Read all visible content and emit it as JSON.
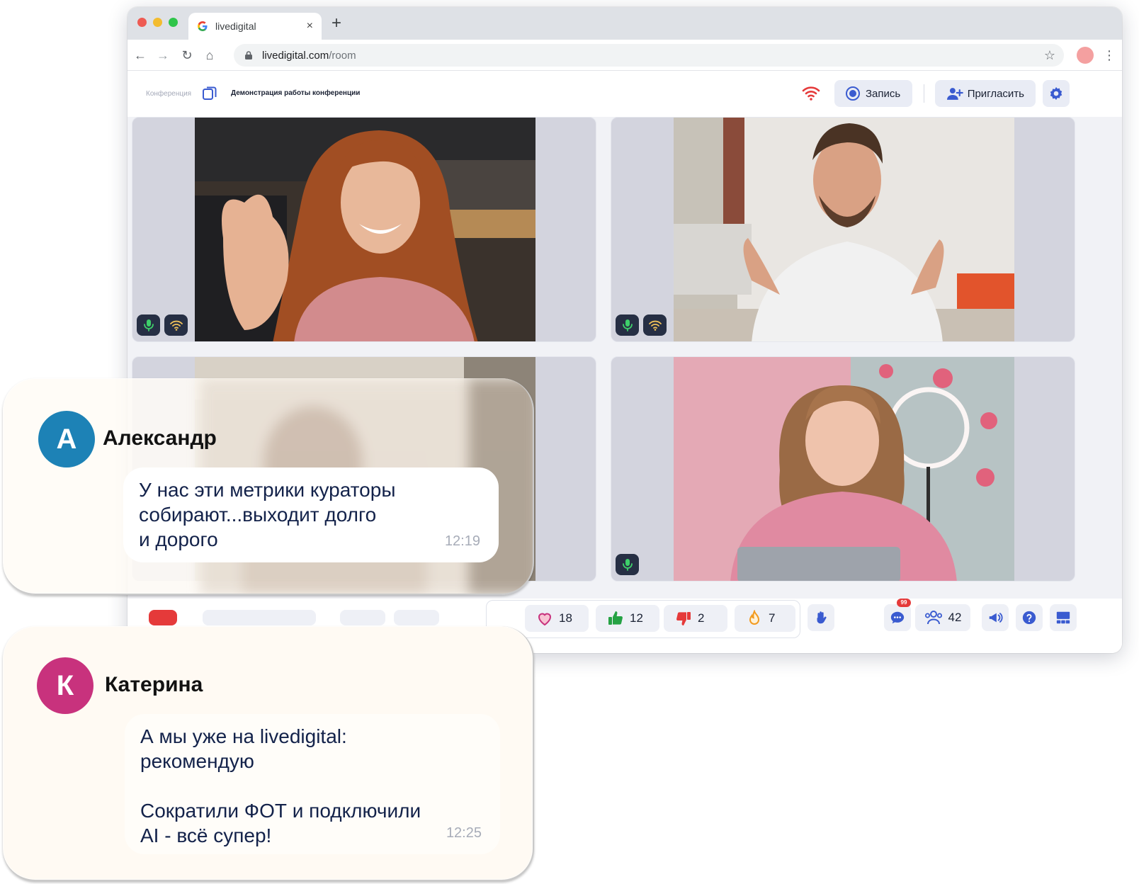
{
  "browser": {
    "tab_title": "livedigital",
    "new_tab": "+",
    "close_tab": "×",
    "url_domain": "livedigital.com",
    "url_path": "/room"
  },
  "header": {
    "breadcrumb": "Конференция",
    "conference_title": "Демонстрация работы конференции",
    "record_label": "Запись",
    "invite_label": "Пригласить"
  },
  "reactions": {
    "heart": "18",
    "like": "12",
    "dislike": "2",
    "fire": "7"
  },
  "footer": {
    "chat_unread": "99",
    "participants_count": "42"
  },
  "messages": [
    {
      "avatar_letter": "А",
      "sender": "Александр",
      "text": "У нас эти метрики кураторы\nсобирают...выходит долго\nи дорого",
      "time": "12:19",
      "avatar_color": "#1d82b6"
    },
    {
      "avatar_letter": "К",
      "sender": "Катерина",
      "text": "А мы уже на livedigital:\nрекомендую\n\nСократили ФОТ и подключили\nAI - всё супер!",
      "time": "12:25",
      "avatar_color": "#c8327d"
    }
  ],
  "colors": {
    "accent": "#3a5bd0",
    "tile_bg": "#d3d4de",
    "badge_bg": "#262f44",
    "wifi_warning": "#e53a3a"
  },
  "icons": [
    "google-icon",
    "lock-icon",
    "star-icon",
    "copy-icon",
    "wifi-icon",
    "record-icon",
    "add-user-icon",
    "gear-icon",
    "mic-icon",
    "heart-icon",
    "thumbs-up-icon",
    "thumbs-down-icon",
    "fire-icon",
    "raise-hand-icon",
    "chat-icon",
    "participants-icon",
    "megaphone-icon",
    "help-icon",
    "layout-icon"
  ]
}
